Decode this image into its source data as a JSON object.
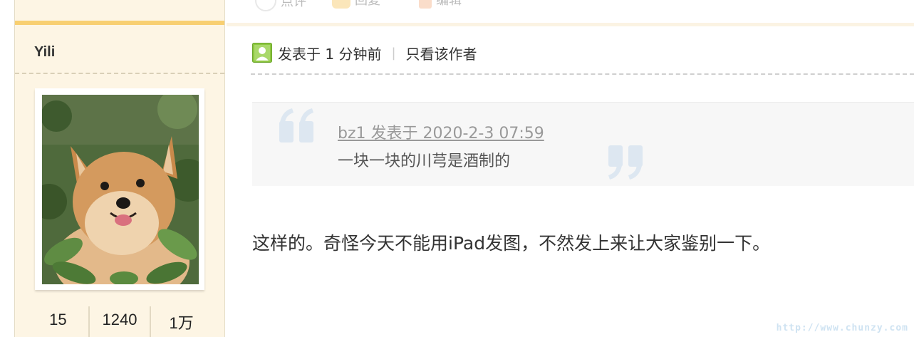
{
  "toolbar": {
    "items": [
      {
        "label": "点评",
        "icon": "comment-icon"
      },
      {
        "label": "回复",
        "icon": "reply-icon"
      },
      {
        "label": "编辑",
        "icon": "edit-icon"
      }
    ]
  },
  "author": {
    "name": "Yili",
    "avatar": "pomeranian-dog-photo",
    "stats": [
      "15",
      "1240",
      "1万"
    ]
  },
  "post": {
    "header": {
      "posted": "发表于 1 分钟前",
      "separator": "|",
      "only_author": "只看该作者"
    },
    "quote": {
      "cite": "bz1 发表于 2020-2-3 07:59",
      "text": "一块一块的川芎是酒制的"
    },
    "body": "这样的。奇怪今天不能用iPad发图，不然发上来让大家鉴别一下。"
  },
  "watermark": "http://www.chunzy.com",
  "colors": {
    "sidebar_bg": "#fdf5e4",
    "accent_bar": "#f8cf71",
    "quote_bg": "#f7f7f7",
    "quote_mark": "#dde7f1",
    "user_icon": "#8cc63f"
  }
}
